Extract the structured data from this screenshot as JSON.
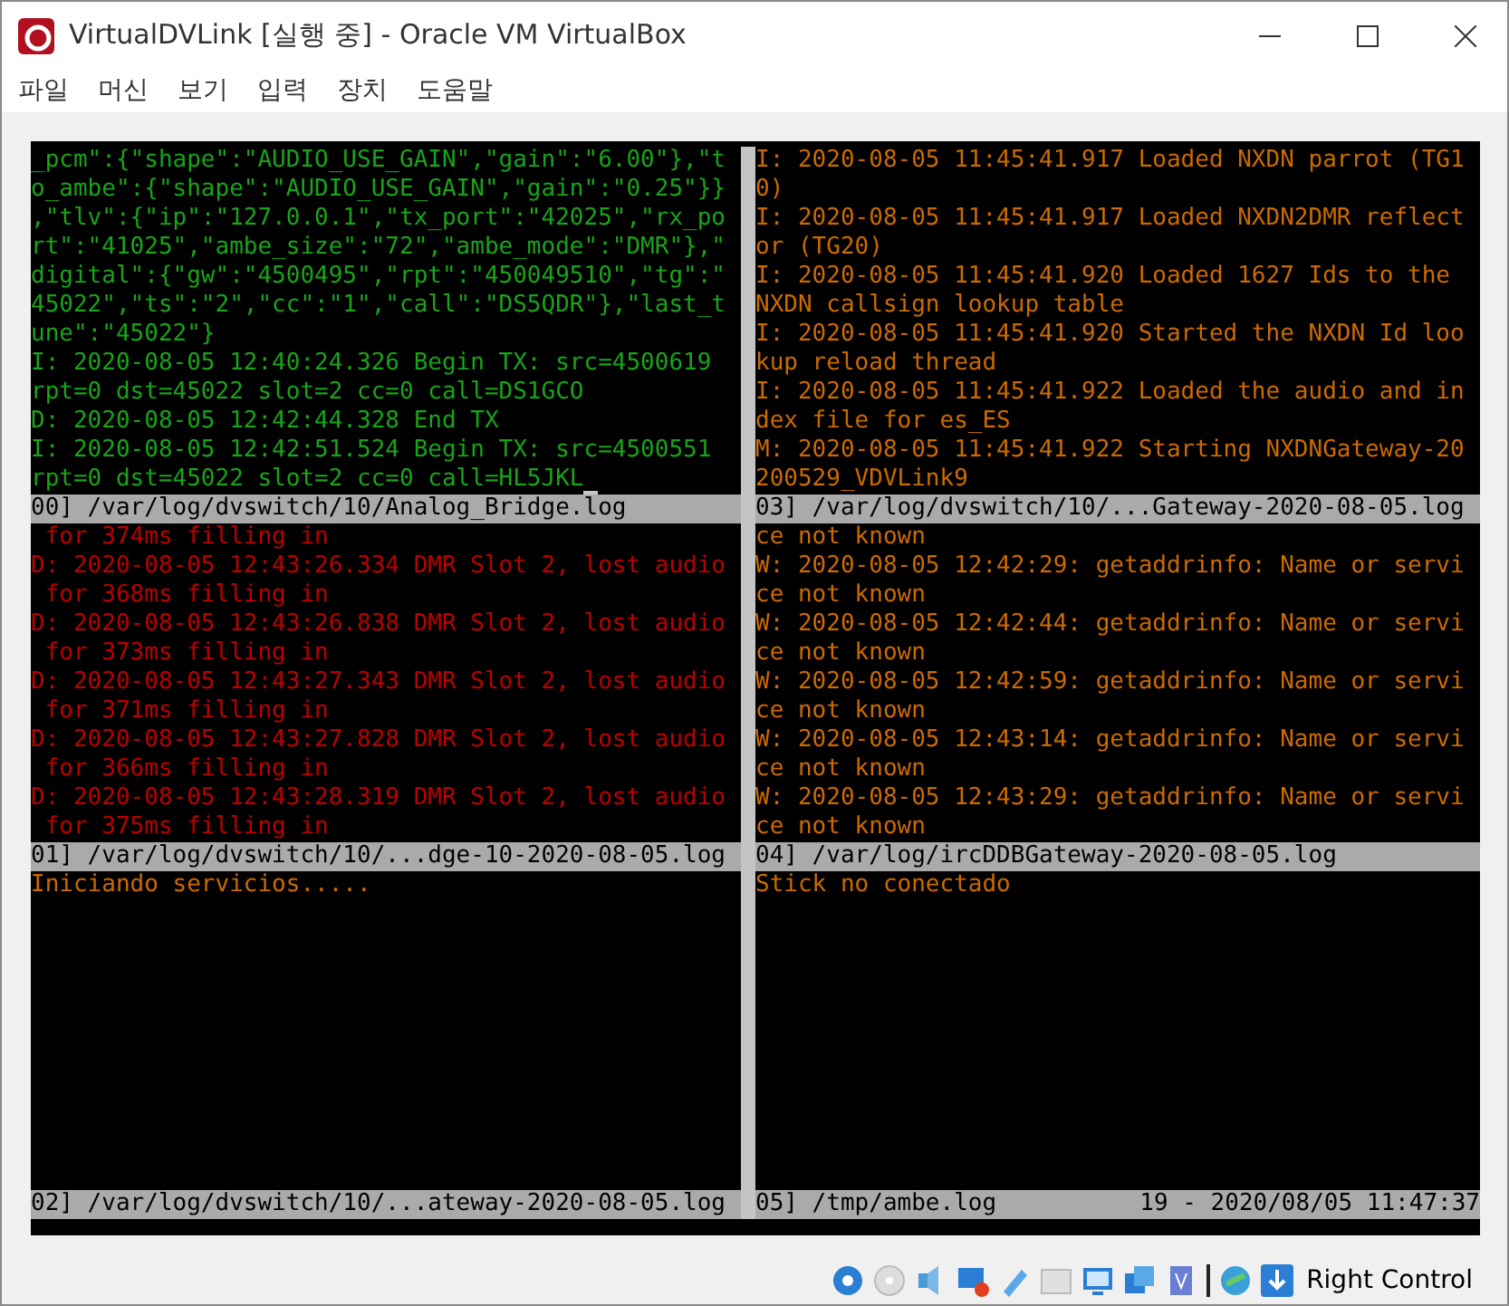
{
  "window": {
    "title": "VirtualDVLink [실행 중] - Oracle VM VirtualBox"
  },
  "menu": [
    "파일",
    "머신",
    "보기",
    "입력",
    "장치",
    "도움말"
  ],
  "panes": [
    {
      "kind": "ok",
      "cursor": true,
      "lines": [
        "_pcm\":{\"shape\":\"AUDIO_USE_GAIN\",\"gain\":\"6.00\"},\"t",
        "o_ambe\":{\"shape\":\"AUDIO_USE_GAIN\",\"gain\":\"0.25\"}}",
        ",\"tlv\":{\"ip\":\"127.0.0.1\",\"tx_port\":\"42025\",\"rx_po",
        "rt\":\"41025\",\"ambe_size\":\"72\",\"ambe_mode\":\"DMR\"},\"",
        "digital\":{\"gw\":\"4500495\",\"rpt\":\"450049510\",\"tg\":\"",
        "45022\",\"ts\":\"2\",\"cc\":\"1\",\"call\":\"DS5QDR\"},\"last_t",
        "une\":\"45022\"}",
        "I: 2020-08-05 12:40:24.326 Begin TX: src=4500619",
        "rpt=0 dst=45022 slot=2 cc=0 call=DS1GCO",
        "D: 2020-08-05 12:42:44.328 End TX",
        "I: 2020-08-05 12:42:51.524 Begin TX: src=4500551",
        "rpt=0 dst=45022 slot=2 cc=0 call=HL5JKL"
      ],
      "status": "00] /var/log/dvswitch/10/Analog_Bridge.log"
    },
    {
      "kind": "warn",
      "cursor": false,
      "lines": [
        "I: 2020-08-05 11:45:41.917 Loaded NXDN parrot (TG1",
        "0)",
        "I: 2020-08-05 11:45:41.917 Loaded NXDN2DMR reflect",
        "or (TG20)",
        "I: 2020-08-05 11:45:41.920 Loaded 1627 Ids to the",
        "NXDN callsign lookup table",
        "I: 2020-08-05 11:45:41.920 Started the NXDN Id loo",
        "kup reload thread",
        "I: 2020-08-05 11:45:41.922 Loaded the audio and in",
        "dex file for es_ES",
        "M: 2020-08-05 11:45:41.922 Starting NXDNGateway-20",
        "200529_VDVLink9"
      ],
      "status": "03] /var/log/dvswitch/10/...Gateway-2020-08-05.log"
    },
    {
      "kind": "error",
      "cursor": false,
      "lines": [
        " for 374ms filling in",
        "D: 2020-08-05 12:43:26.334 DMR Slot 2, lost audio",
        " for 368ms filling in",
        "D: 2020-08-05 12:43:26.838 DMR Slot 2, lost audio",
        " for 373ms filling in",
        "D: 2020-08-05 12:43:27.343 DMR Slot 2, lost audio",
        " for 371ms filling in",
        "D: 2020-08-05 12:43:27.828 DMR Slot 2, lost audio",
        " for 366ms filling in",
        "D: 2020-08-05 12:43:28.319 DMR Slot 2, lost audio",
        " for 375ms filling in"
      ],
      "status": "01] /var/log/dvswitch/10/...dge-10-2020-08-05.log"
    },
    {
      "kind": "warn",
      "cursor": false,
      "lines": [
        "ce not known",
        "W: 2020-08-05 12:42:29: getaddrinfo: Name or servi",
        "ce not known",
        "W: 2020-08-05 12:42:44: getaddrinfo: Name or servi",
        "ce not known",
        "W: 2020-08-05 12:42:59: getaddrinfo: Name or servi",
        "ce not known",
        "W: 2020-08-05 12:43:14: getaddrinfo: Name or servi",
        "ce not known",
        "W: 2020-08-05 12:43:29: getaddrinfo: Name or servi",
        "ce not known"
      ],
      "status": "04] /var/log/ircDDBGateway-2020-08-05.log"
    },
    {
      "kind": "warn",
      "cursor": false,
      "lines": [
        "Iniciando servicios....."
      ],
      "status": "02] /var/log/dvswitch/10/...ateway-2020-08-05.log"
    },
    {
      "kind": "warn",
      "cursor": false,
      "lines": [
        "Stick no conectado"
      ],
      "status": "05] /tmp/ambe.log",
      "status_right": "19 - 2020/08/05 11:47:37"
    }
  ],
  "status_bar": {
    "host_key": "Right Control"
  }
}
